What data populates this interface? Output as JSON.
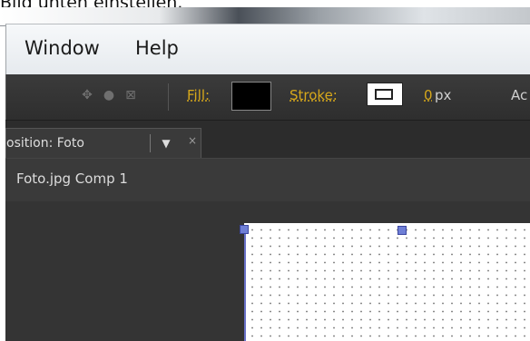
{
  "caption": "Bild unten einstellen.",
  "menubar": {
    "items": [
      "Window",
      "Help"
    ]
  },
  "toolbar": {
    "fill_label": "Fill:",
    "fill_color": "#000000",
    "stroke_label": "Stroke:",
    "stroke_width": "0",
    "stroke_unit": "px",
    "add_label": "Ac",
    "icons": [
      "anchor-point-icon",
      "feather-icon",
      "roto-icon"
    ]
  },
  "panel": {
    "tab_label": "osition: Foto",
    "tab_menu_glyph": "▼",
    "close_glyph": "×"
  },
  "composition": {
    "name": "Foto.jpg Comp 1"
  },
  "colors": {
    "accent": "#d7a81b",
    "handle": "#6f7fd6",
    "panel_bg": "#343434"
  }
}
